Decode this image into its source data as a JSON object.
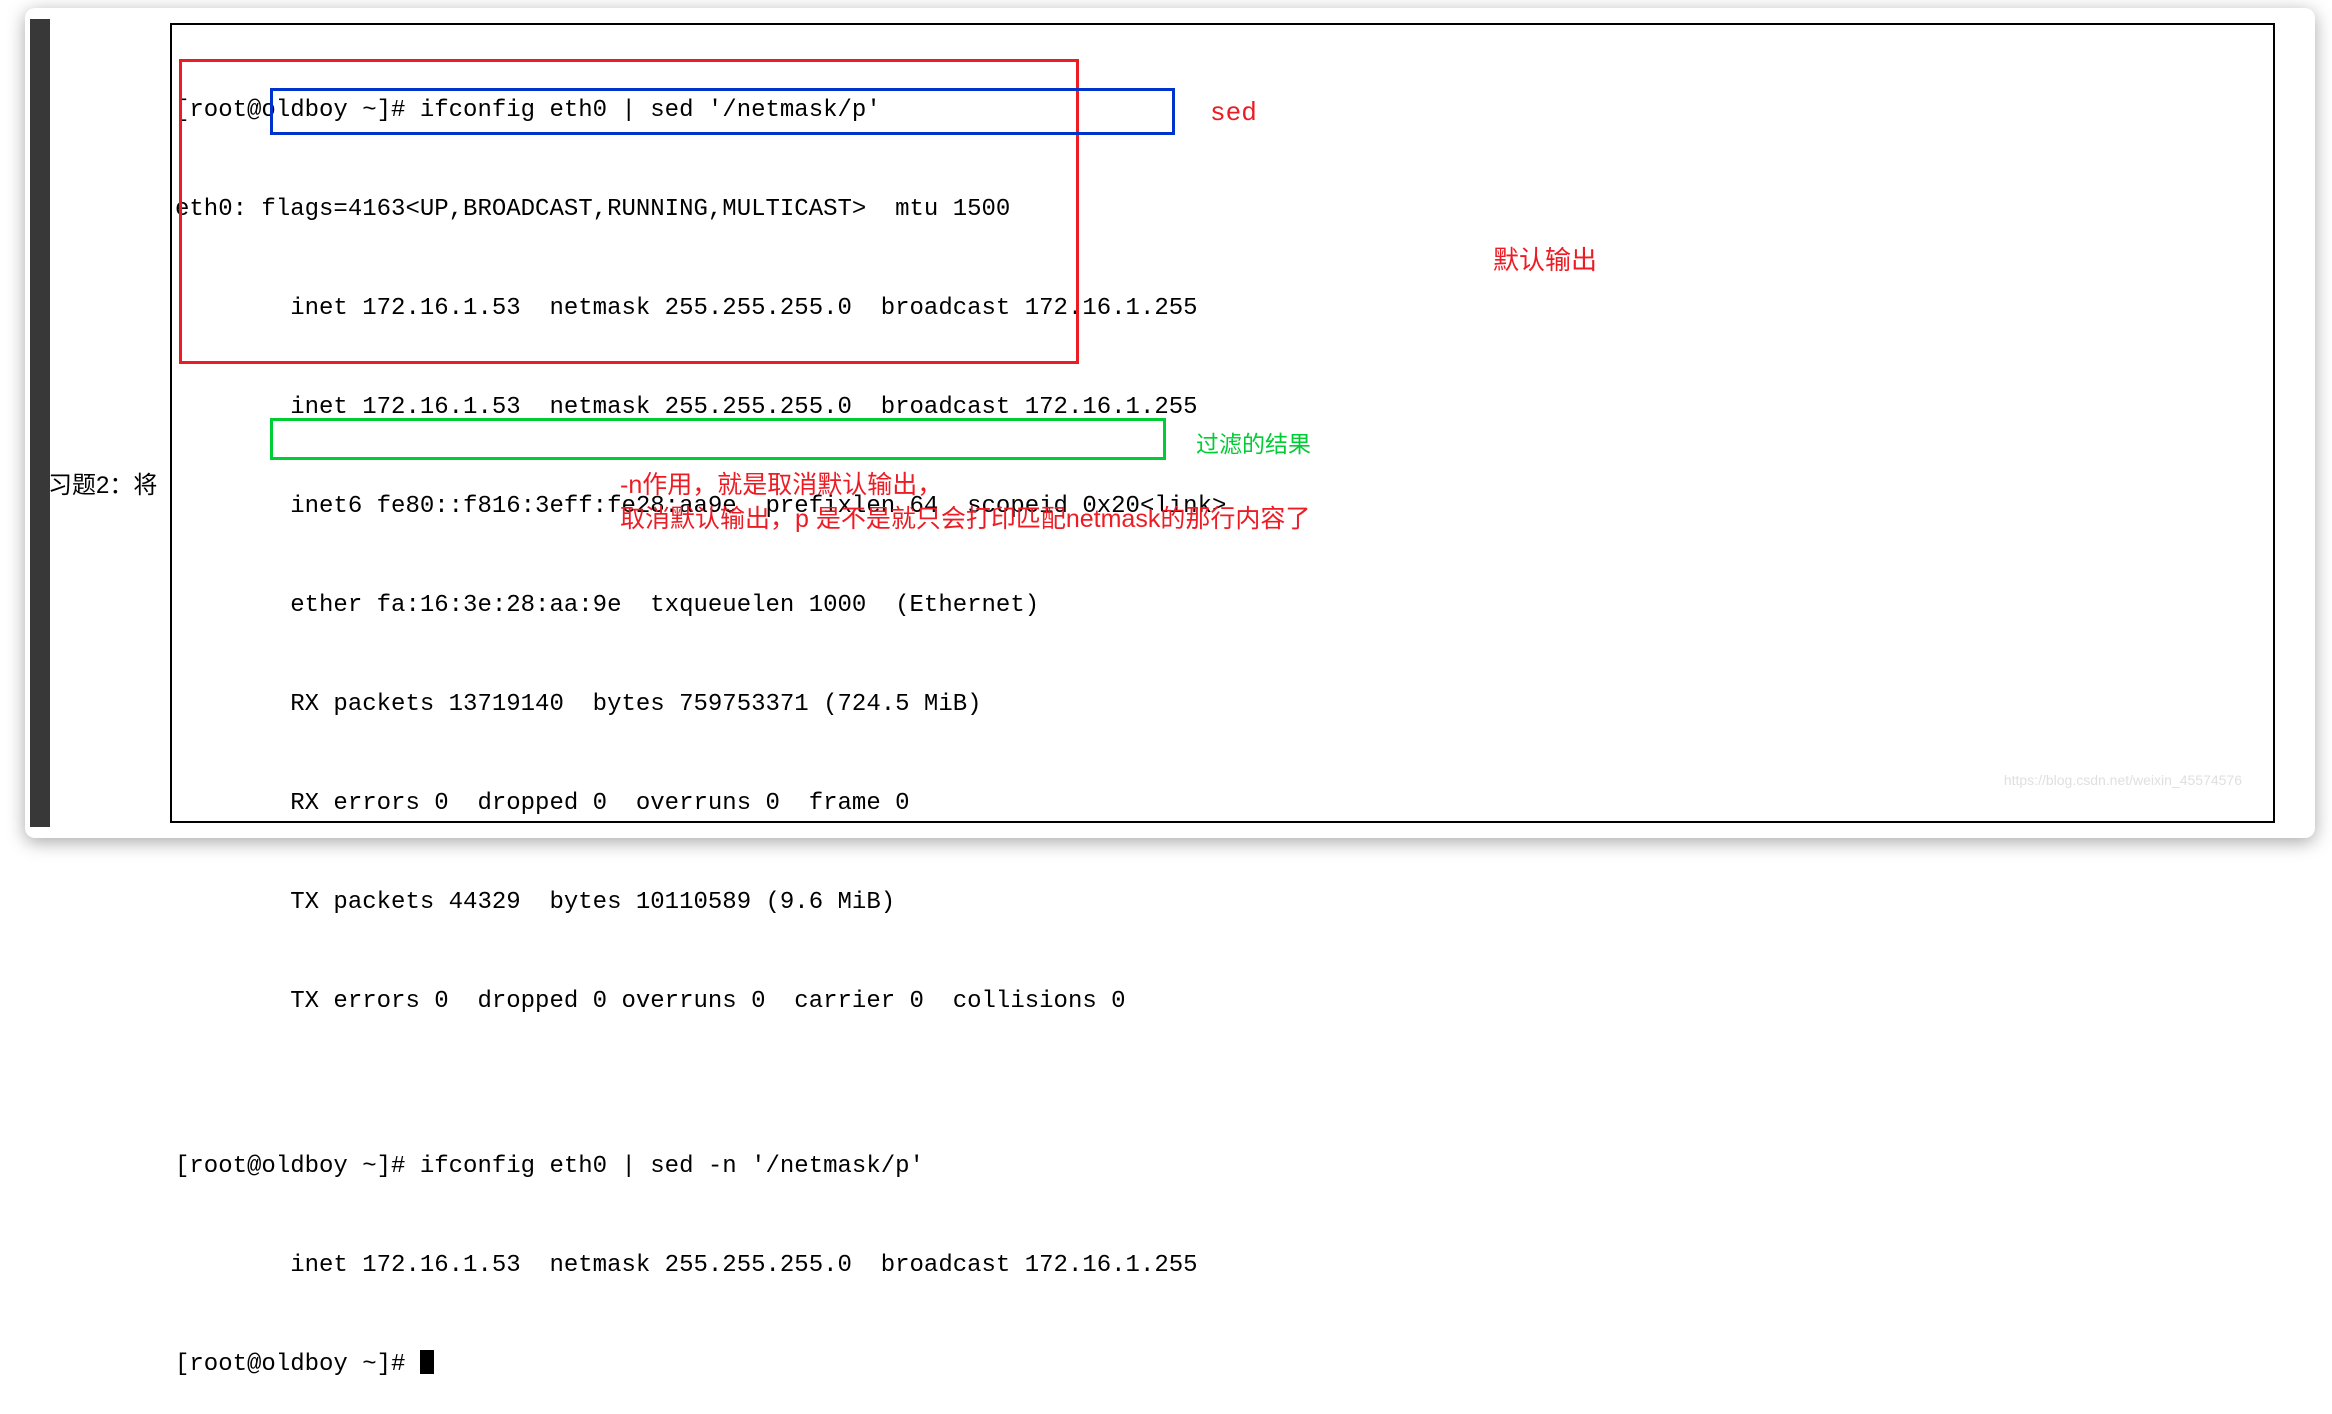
{
  "terminal": {
    "prompt": "[root@oldboy ~]# ",
    "cmd1": "ifconfig eth0 | sed '/netmask/p'",
    "out1_line1": "eth0: flags=4163<UP,BROADCAST,RUNNING,MULTICAST>  mtu 1500",
    "out1_line2": "        inet 172.16.1.53  netmask 255.255.255.0  broadcast 172.16.1.255",
    "out1_line3": "        inet 172.16.1.53  netmask 255.255.255.0  broadcast 172.16.1.255",
    "out1_line4": "        inet6 fe80::f816:3eff:fe28:aa9e  prefixlen 64  scopeid 0x20<link>",
    "out1_line5": "        ether fa:16:3e:28:aa:9e  txqueuelen 1000  (Ethernet)",
    "out1_line6": "        RX packets 13719140  bytes 759753371 (724.5 MiB)",
    "out1_line7": "        RX errors 0  dropped 0  overruns 0  frame 0",
    "out1_line8": "        TX packets 44329  bytes 10110589 (9.6 MiB)",
    "out1_line9": "        TX errors 0  dropped 0 overruns 0  carrier 0  collisions 0",
    "blank": "",
    "cmd2": "ifconfig eth0 | sed -n '/netmask/p'",
    "out2_line1": "        inet 172.16.1.53  netmask 255.255.255.0  broadcast 172.16.1.255"
  },
  "annotations": {
    "sed_label": "sed",
    "default_output": "默认输出",
    "filtered_result": "过滤的结果",
    "n_explain_line1": "-n作用，就是取消默认输出，",
    "n_explain_line2": "取消默认输出，p 是不是就只会打印匹配netmask的那行内容了"
  },
  "exercise": {
    "label": "习题2：将"
  },
  "watermark": "https://blog.csdn.net/weixin_45574576",
  "colors": {
    "red": "#ed1c24",
    "blue": "#0033cc",
    "green": "#00cc33"
  }
}
